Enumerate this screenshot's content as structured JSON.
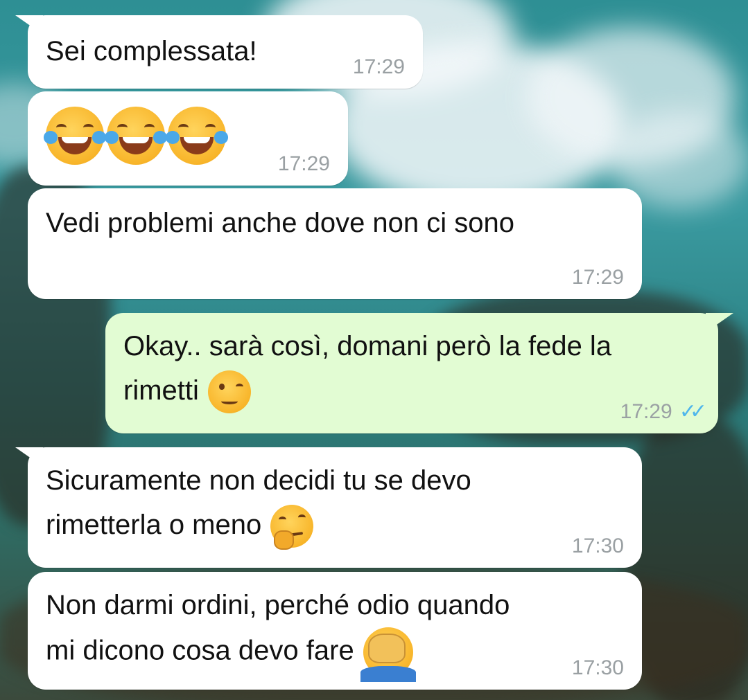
{
  "chat": {
    "messages": [
      {
        "direction": "incoming",
        "text": "Sei complessata!",
        "time": "17:29"
      },
      {
        "direction": "incoming",
        "text": "",
        "emoji": [
          "face-with-tears-of-joy",
          "face-with-tears-of-joy",
          "face-with-tears-of-joy"
        ],
        "time": "17:29"
      },
      {
        "direction": "incoming",
        "text": "Vedi problemi anche dove non ci sono",
        "time": "17:29"
      },
      {
        "direction": "outgoing",
        "text_line1": "Okay.. sarà così, domani però la fede la",
        "text_line2": "rimetti",
        "emoji": [
          "winking-face"
        ],
        "time": "17:29",
        "status_icon": "double-check-read-icon",
        "status_color": "#4fb6ec"
      },
      {
        "direction": "incoming",
        "text_line1": "Sicuramente non decidi tu se devo",
        "text_line2": "rimetterla o meno",
        "emoji": [
          "thinking-face"
        ],
        "time": "17:30"
      },
      {
        "direction": "incoming",
        "text_line1": "Non darmi ordini, perché odio quando",
        "text_line2": "mi dicono cosa devo fare",
        "emoji": [
          "man-facepalming"
        ],
        "time": "17:30"
      }
    ]
  },
  "colors": {
    "incoming_bubble": "#ffffff",
    "outgoing_bubble": "#e2fcd3",
    "timestamp": "#9aa0a3"
  }
}
